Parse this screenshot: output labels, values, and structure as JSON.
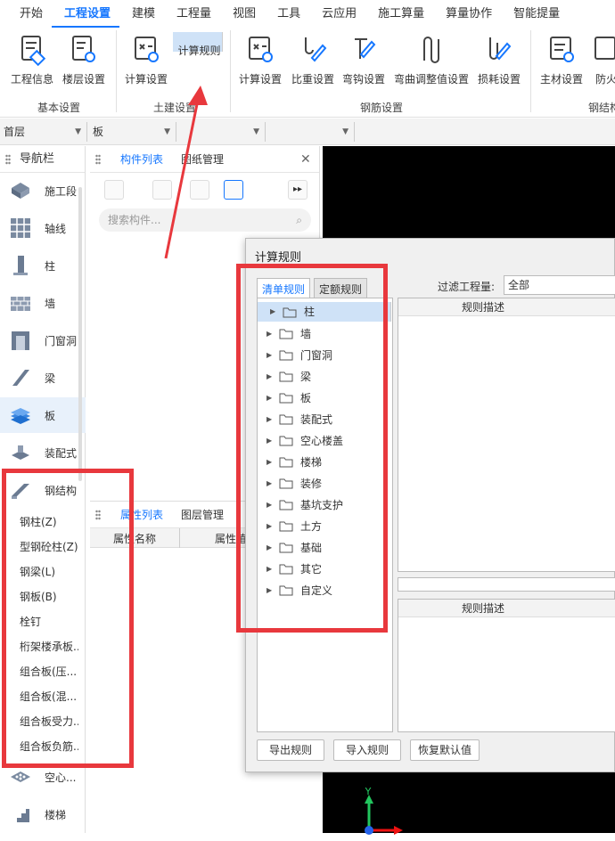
{
  "menubar": {
    "items": [
      "开始",
      "工程设置",
      "建模",
      "工程量",
      "视图",
      "工具",
      "云应用",
      "施工算量",
      "算量协作",
      "智能提量"
    ],
    "active_index": 1
  },
  "ribbon": {
    "groups": [
      {
        "label": "基本设置",
        "buttons": [
          "工程信息",
          "楼层设置"
        ]
      },
      {
        "label": "土建设置",
        "buttons": [
          "计算设置",
          "计算规则"
        ]
      },
      {
        "label": "钢筋设置",
        "buttons": [
          "计算设置",
          "比重设置",
          "弯钩设置",
          "弯曲调整值设置",
          "损耗设置"
        ]
      },
      {
        "label": "钢结构",
        "buttons": [
          "主材设置",
          "防火"
        ]
      }
    ],
    "selected_button": "计算规则"
  },
  "selectors": {
    "floor": "首层",
    "type": "板",
    "third": "",
    "fourth": ""
  },
  "nav": {
    "title": "导航栏",
    "items": [
      "施工段",
      "轴线",
      "柱",
      "墙",
      "门窗洞",
      "梁",
      "板",
      "装配式",
      "钢结构",
      "空心...",
      "楼梯"
    ],
    "active_item": "板",
    "expanded_item": "钢结构",
    "sub_items": [
      "钢柱(Z)",
      "型钢砼柱(Z)",
      "钢梁(L)",
      "钢板(B)",
      "栓钉",
      "桁架楼承板...",
      "组合板(压...",
      "组合板(混...",
      "组合板受力...",
      "组合板负筋..."
    ]
  },
  "component_panel": {
    "tabs": [
      "构件列表",
      "图纸管理"
    ],
    "active_tab": "构件列表",
    "search_placeholder": "搜索构件...",
    "close_icon": "close-icon"
  },
  "attr_panel": {
    "tabs": [
      "属性列表",
      "图层管理"
    ],
    "active_tab": "属性列表",
    "col_name": "属性名称",
    "col_value": "属性值"
  },
  "dialog": {
    "title": "计算规则",
    "tabs": [
      "清单规则",
      "定额规则"
    ],
    "active_tab": "清单规则",
    "filter_label": "过滤工程量:",
    "filter_value": "全部",
    "tree": [
      "柱",
      "墙",
      "门窗洞",
      "梁",
      "板",
      "装配式",
      "空心楼盖",
      "楼梯",
      "装修",
      "基坑支护",
      "土方",
      "基础",
      "其它",
      "自定义"
    ],
    "selected_node": "柱",
    "rule_header_top": "规则描述",
    "rule_header_bottom": "规则描述",
    "buttons": [
      "导出规则",
      "导入规则",
      "恢复默认值"
    ]
  },
  "axis": {
    "y": "Y"
  },
  "colors": {
    "accent": "#1677ff",
    "highlight": "#e8383d",
    "selected_bg": "#cfe2f7"
  }
}
